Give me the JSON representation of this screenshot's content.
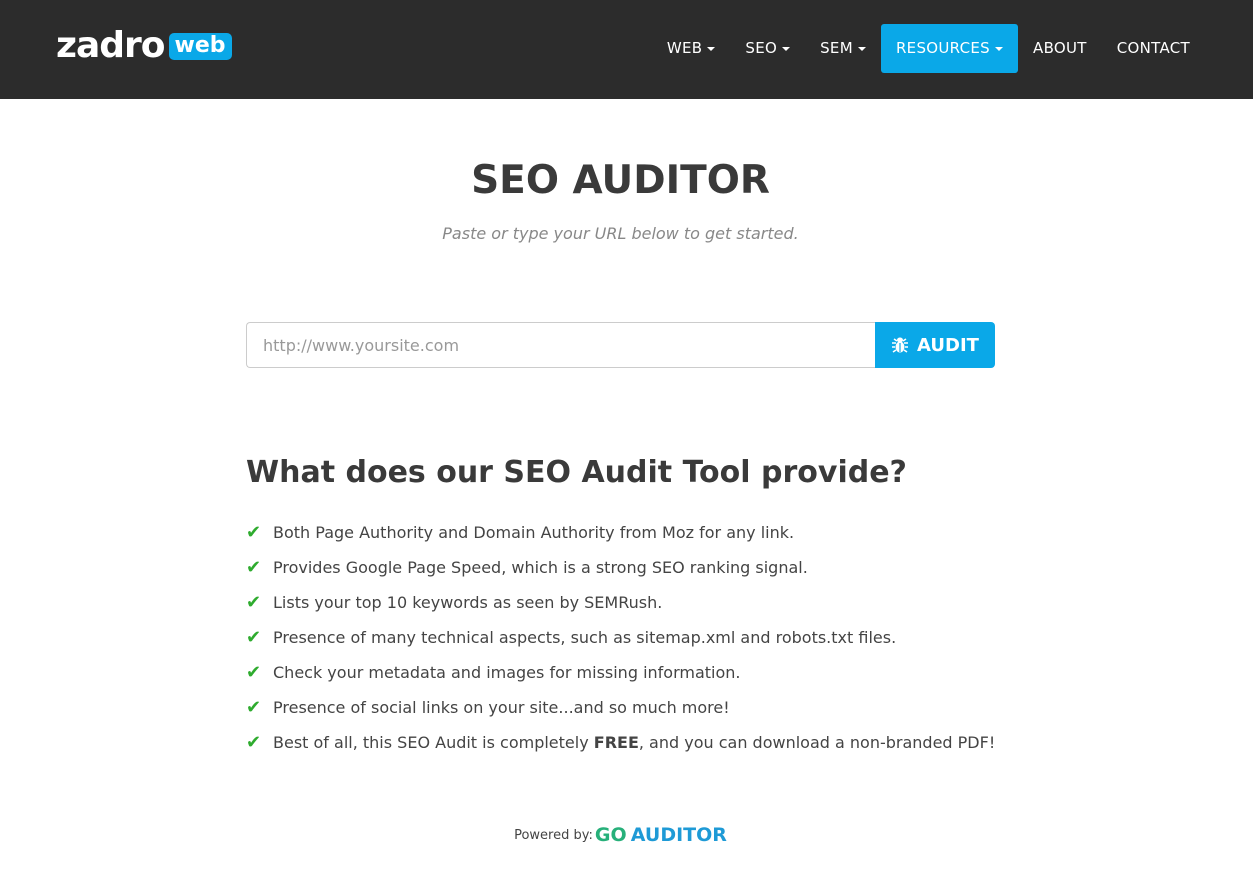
{
  "header": {
    "logo_text": "zadro",
    "logo_badge": "web",
    "nav": [
      {
        "label": "WEB",
        "dropdown": true
      },
      {
        "label": "SEO",
        "dropdown": true
      },
      {
        "label": "SEM",
        "dropdown": true
      },
      {
        "label": "RESOURCES",
        "dropdown": true,
        "active": true
      },
      {
        "label": "ABOUT"
      },
      {
        "label": "CONTACT"
      }
    ]
  },
  "main": {
    "title": "SEO AUDITOR",
    "subtitle": "Paste or type your URL below to get started.",
    "url_placeholder": "http://www.yoursite.com",
    "url_value": "",
    "audit_label": "AUDIT",
    "audit_icon": "bug-icon",
    "features_title": "What does our SEO Audit Tool provide?",
    "features": [
      "Both Page Authority and Domain Authority from Moz for any link.",
      "Provides Google Page Speed, which is a strong SEO ranking signal.",
      "Lists your top 10 keywords as seen by SEMRush.",
      "Presence of many technical aspects, such as sitemap.xml and robots.txt files.",
      "Check your metadata and images for missing information.",
      "Presence of social links on your site...and so much more!"
    ],
    "last_feature": {
      "pre": "Best of all, this SEO Audit is completely ",
      "bold": "FREE",
      "post": ", and you can download a non-branded PDF!"
    }
  },
  "footer": {
    "powered": "Powered by:",
    "brand_go": "GO",
    "brand_auditor": "AUDITOR"
  },
  "colors": {
    "accent": "#0aa8e8",
    "header_bg": "#2c2c2c",
    "check": "#2eab2e"
  }
}
